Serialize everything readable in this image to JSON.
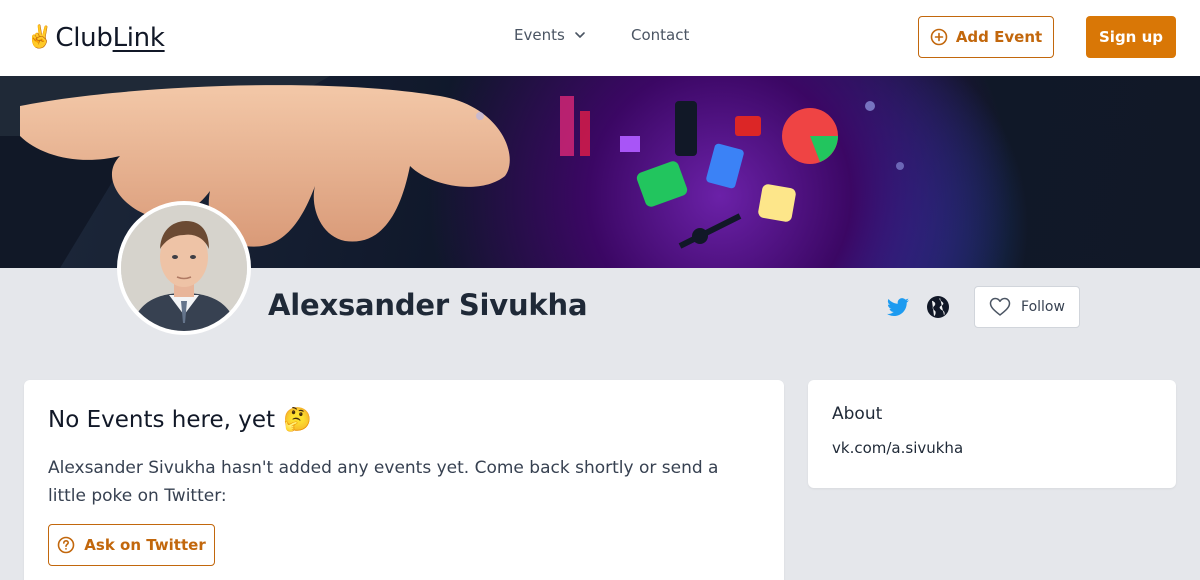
{
  "header": {
    "logo_emoji": "✌️",
    "logo_part1": "Club",
    "logo_part2": "Link",
    "nav_events": "Events",
    "nav_contact": "Contact",
    "add_event_label": "Add Event",
    "signup_label": "Sign up"
  },
  "profile": {
    "name": "Alexsander Sivukha",
    "follow_label": "Follow"
  },
  "events_card": {
    "title": "No Events here, yet",
    "title_emoji": "🤔",
    "description": "Alexsander Sivukha hasn't added any events yet. Come back shortly or send a little poke on Twitter:",
    "ask_label": "Ask on Twitter"
  },
  "about_card": {
    "title": "About",
    "link": "vk.com/a.sivukha"
  },
  "colors": {
    "accent": "#d97706",
    "accent_dark": "#c2670c",
    "twitter": "#1d9bf0",
    "page_bg": "#e5e7eb"
  }
}
